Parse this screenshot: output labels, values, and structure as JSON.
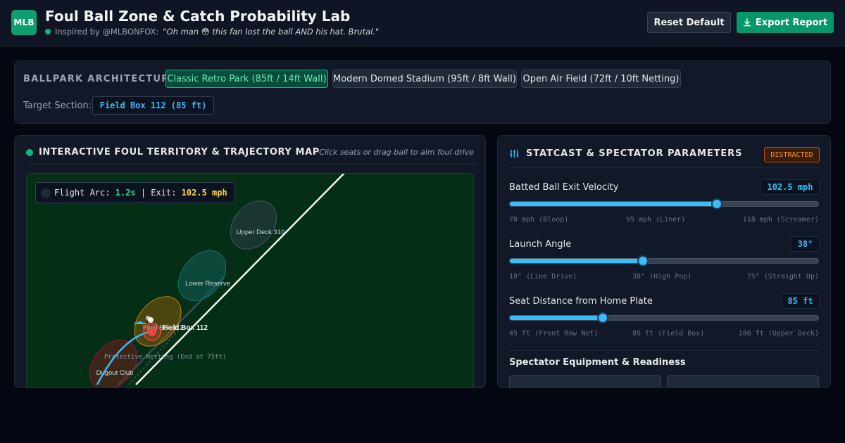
{
  "header": {
    "logo": "MLB",
    "title": "Foul Ball Zone & Catch Probability Lab",
    "inspired_label": "Inspired by @MLBONFOX:",
    "quote": "\"Oh man 😳 this fan lost the ball AND his hat. Brutal.\"",
    "reset_label": "Reset Default",
    "export_label": "Export Report"
  },
  "architecture": {
    "label": "BALLPARK ARCHITECTURE:",
    "options": [
      {
        "label": "Classic Retro Park (85ft / 14ft Wall)",
        "active": true
      },
      {
        "label": "Modern Domed Stadium (95ft / 8ft Wall)",
        "active": false
      },
      {
        "label": "Open Air Field (72ft / 10ft Netting)",
        "active": false
      }
    ],
    "target_label": "Target Section:",
    "target_value": "Field Box 112 (85 ft)"
  },
  "map": {
    "title": "INTERACTIVE FOUL TERRITORY & TRAJECTORY MAP",
    "hint": "Click seats or drag ball to aim foul drive",
    "flight_label": "Flight Arc:",
    "flight_value": "1.2s",
    "exit_label": "| Exit:",
    "exit_value": "102.5 mph",
    "zones": [
      "Upper Deck 310",
      "Lower Reserve",
      "Field Box 112",
      "Dugout Club"
    ],
    "netting_label": "Protective Netting (End at 75ft)"
  },
  "stats": {
    "title": "STATCAST & SPECTATOR PARAMETERS",
    "status": "DISTRACTED",
    "params": [
      {
        "label": "Batted Ball Exit Velocity",
        "value": "102.5 mph",
        "fraction": 0.672,
        "ticks": [
          "70 mph (Bloop)",
          "95 mph (Liner)",
          "118 mph (Screamer)"
        ]
      },
      {
        "label": "Launch Angle",
        "value": "38°",
        "fraction": 0.432,
        "ticks": [
          "10° (Line Drive)",
          "38° (High Pop)",
          "75° (Straight Up)"
        ]
      },
      {
        "label": "Seat Distance from Home Plate",
        "value": "85 ft",
        "fraction": 0.302,
        "ticks": [
          "45 ft (Front Row Net)",
          "85 ft (Field Box)",
          "180 ft (Upper Deck)"
        ]
      }
    ],
    "equipment_title": "Spectator Equipment & Readiness"
  },
  "colors": {
    "accent": "#38bdf8",
    "brand": "#059669",
    "warning": "#fb923c"
  }
}
